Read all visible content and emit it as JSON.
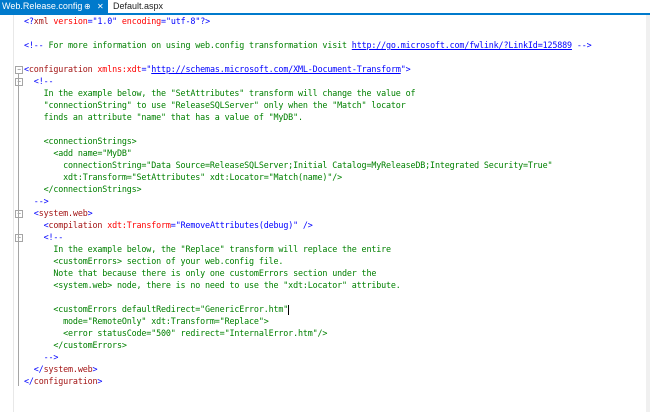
{
  "tabs": [
    {
      "label": "Web.Release.config",
      "active": true,
      "pin_icon": "pin-icon",
      "close_icon": "close-icon"
    },
    {
      "label": "Default.aspx",
      "active": false
    }
  ],
  "colors": {
    "accent": "#007acc",
    "comment": "#008000",
    "tag": "#a31515",
    "attribute": "#ff0000",
    "value": "#0000ff"
  },
  "lines": [
    [
      [
        "pi",
        "<?"
      ],
      [
        "tag",
        "xml"
      ],
      [
        "attr",
        " version"
      ],
      [
        "pun",
        "=\""
      ],
      [
        "val",
        "1.0"
      ],
      [
        "pun",
        "\""
      ],
      [
        "attr",
        " encoding"
      ],
      [
        "pun",
        "=\""
      ],
      [
        "val",
        "utf-8"
      ],
      [
        "pun",
        "\"?>"
      ]
    ],
    [],
    [
      [
        "pun",
        "<!--"
      ],
      [
        "com",
        " For more information on using web.config transformation visit "
      ],
      [
        "link",
        "http://go.microsoft.com/fwlink/?LinkId=125889"
      ],
      [
        "com",
        " "
      ],
      [
        "pun",
        "-->"
      ]
    ],
    [],
    [
      [
        "pun",
        "<"
      ],
      [
        "tag",
        "configuration"
      ],
      [
        "attr",
        " xmlns:xdt"
      ],
      [
        "pun",
        "=\""
      ],
      [
        "link",
        "http://schemas.microsoft.com/XML-Document-Transform"
      ],
      [
        "pun",
        "\">"
      ]
    ],
    [
      [
        "com",
        "  "
      ],
      [
        "pun",
        "<!--"
      ]
    ],
    [
      [
        "com",
        "    In the example below, the \"SetAttributes\" transform will change the value of"
      ]
    ],
    [
      [
        "com",
        "    \"connectionString\" to use \"ReleaseSQLServer\" only when the \"Match\" locator"
      ]
    ],
    [
      [
        "com",
        "    finds an attribute \"name\" that has a value of \"MyDB\"."
      ]
    ],
    [],
    [
      [
        "com",
        "    <connectionStrings>"
      ]
    ],
    [
      [
        "com",
        "      <add name=\"MyDB\""
      ]
    ],
    [
      [
        "com",
        "        connectionString=\"Data Source=ReleaseSQLServer;Initial Catalog=MyReleaseDB;Integrated Security=True\""
      ]
    ],
    [
      [
        "com",
        "        xdt:Transform=\"SetAttributes\" xdt:Locator=\"Match(name)\"/>"
      ]
    ],
    [
      [
        "com",
        "    </connectionStrings>"
      ]
    ],
    [
      [
        "com",
        "  "
      ],
      [
        "pun",
        "-->"
      ]
    ],
    [
      [
        "pun",
        "  <"
      ],
      [
        "tag",
        "system.web"
      ],
      [
        "pun",
        ">"
      ]
    ],
    [
      [
        "pun",
        "    <"
      ],
      [
        "tag",
        "compilation"
      ],
      [
        "attr",
        " xdt:Transform"
      ],
      [
        "pun",
        "=\""
      ],
      [
        "val",
        "RemoveAttributes(debug)"
      ],
      [
        "pun",
        "\" />"
      ]
    ],
    [
      [
        "com",
        "    "
      ],
      [
        "pun",
        "<!--"
      ]
    ],
    [
      [
        "com",
        "      In the example below, the \"Replace\" transform will replace the entire"
      ]
    ],
    [
      [
        "com",
        "      <customErrors> section of your web.config file."
      ]
    ],
    [
      [
        "com",
        "      Note that because there is only one customErrors section under the"
      ]
    ],
    [
      [
        "com",
        "      <system.web> node, there is no need to use the \"xdt:Locator\" attribute."
      ]
    ],
    [],
    [
      [
        "com",
        "      <customErrors defaultRedirect=\"GenericError.htm\""
      ],
      [
        "caret",
        ""
      ]
    ],
    [
      [
        "com",
        "        mode=\"RemoteOnly\" xdt:Transform=\"Replace\">"
      ]
    ],
    [
      [
        "com",
        "        <error statusCode=\"500\" redirect=\"InternalError.htm\"/>"
      ]
    ],
    [
      [
        "com",
        "      </customErrors>"
      ]
    ],
    [
      [
        "com",
        "    "
      ],
      [
        "pun",
        "-->"
      ]
    ],
    [
      [
        "pun",
        "  </"
      ],
      [
        "tag",
        "system.web"
      ],
      [
        "pun",
        ">"
      ]
    ],
    [
      [
        "pun",
        "</"
      ],
      [
        "tag",
        "configuration"
      ],
      [
        "pun",
        ">"
      ]
    ]
  ],
  "folds": [
    {
      "line": 4,
      "symbol": "−"
    },
    {
      "line": 5,
      "symbol": "−"
    },
    {
      "line": 16,
      "symbol": "−"
    },
    {
      "line": 18,
      "symbol": "−"
    }
  ]
}
